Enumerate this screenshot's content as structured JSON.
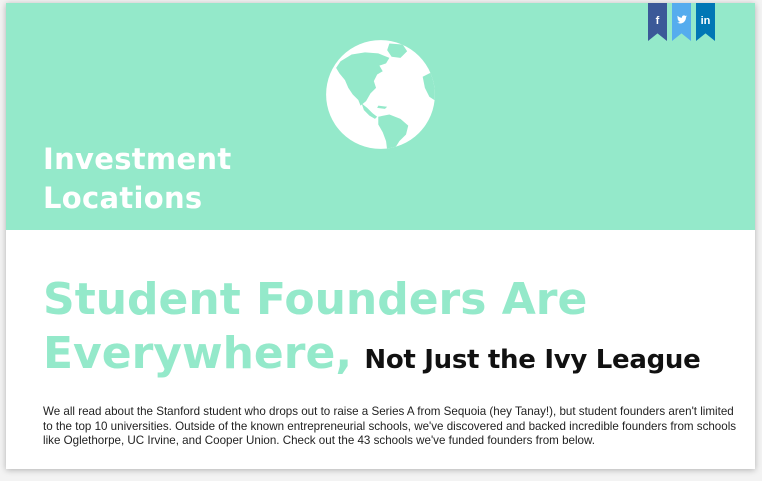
{
  "colors": {
    "hero_bg": "#94e9ca",
    "headline_accent": "#94e9ca",
    "facebook": "#3b5998",
    "twitter": "#55acee",
    "linkedin": "#0077b5"
  },
  "hero": {
    "icon": "globe-icon",
    "title_line1": "Investment",
    "title_line2": "Locations"
  },
  "social": [
    {
      "name": "facebook",
      "glyph": "f"
    },
    {
      "name": "twitter",
      "glyph": "t"
    },
    {
      "name": "linkedin",
      "glyph": "in"
    }
  ],
  "headline": {
    "line1": "Student Founders Are",
    "line2_accent": "Everywhere,",
    "line2_rest": "Not Just the Ivy League"
  },
  "body": {
    "paragraph": "We all read about the Stanford student who drops out to raise a Series A from Sequoia (hey Tanay!), but student founders aren't limited to the top 10 universities. Outside of the known entrepreneurial schools, we've discovered and backed incredible founders from schools like Oglethorpe, UC Irvine, and Cooper Union. Check out the 43 schools we've funded founders from below."
  }
}
